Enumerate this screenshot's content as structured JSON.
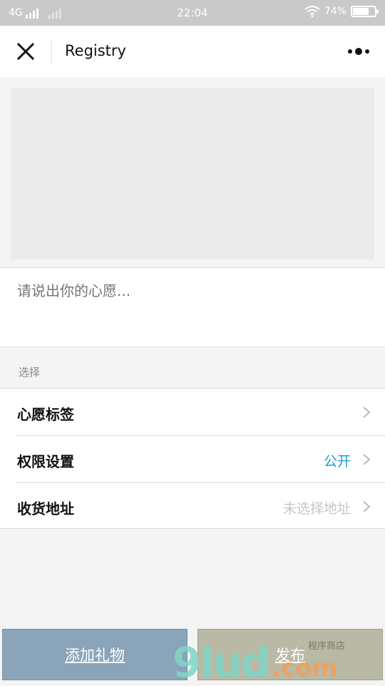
{
  "status_bar": {
    "network": "4G",
    "time": "22:04",
    "battery": "74%",
    "battery_level": 0.74
  },
  "nav": {
    "title": "Registry",
    "close_icon": "close-icon",
    "more_icon": "more-dots-icon"
  },
  "wish": {
    "placeholder": "请说出你的心愿..."
  },
  "section": {
    "label": "选择"
  },
  "rows": [
    {
      "label": "心愿标签",
      "value": ""
    },
    {
      "label": "权限设置",
      "value": "公开"
    },
    {
      "label": "收货地址",
      "value": "未选择地址"
    }
  ],
  "buttons": {
    "add_gift": "添加礼物",
    "publish": "发布"
  },
  "watermark": {
    "main": "9lud",
    "suffix": ".com",
    "tag": "程序商店"
  },
  "colors": {
    "accent_value": "#1b9bd1",
    "muted_value": "#c7c7c7",
    "add_button": "#8aa4ba",
    "publish_button": "#b9b9a5"
  }
}
